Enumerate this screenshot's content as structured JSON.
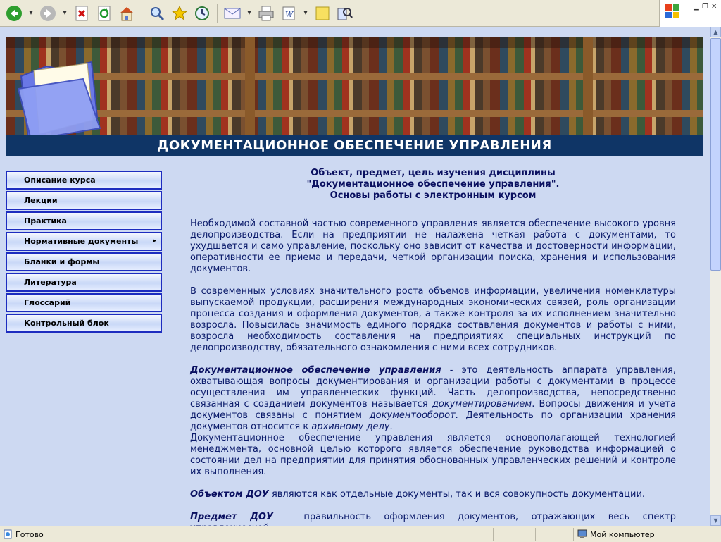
{
  "toolbar": {
    "buttons": [
      "back-icon",
      "forward-icon",
      "stop-icon",
      "refresh-icon",
      "home-icon",
      "search-icon",
      "favorites-icon",
      "history-icon",
      "mail-icon",
      "print-icon",
      "word-icon",
      "note-icon",
      "research-icon"
    ]
  },
  "header": {
    "title": "ДОКУМЕНТАЦИОННОЕ ОБЕСПЕЧЕНИЕ УПРАВЛЕНИЯ"
  },
  "menu": {
    "items": [
      {
        "label": "Описание курса"
      },
      {
        "label": "Лекции"
      },
      {
        "label": "Практика"
      },
      {
        "label": "Нормативные документы",
        "arrow": "▸"
      },
      {
        "label": "Бланки и формы"
      },
      {
        "label": "Литература"
      },
      {
        "label": "Глоссарий"
      },
      {
        "label": "Контрольный блок"
      }
    ]
  },
  "main": {
    "heading_line1": "Объект, предмет, цель изучения дисциплины",
    "heading_line2": "\"Документационное обеспечение управления\".",
    "heading_line3": "Основы работы с электронным курсом",
    "p1": "Необходимой составной частью современного управления является обеспечение высокого уровня делопроизводства. Если на предприятии не налажена четкая работа с документами, то ухудшается и само управление, поскольку оно зависит от качества и достоверности информации, оперативности ее приема и передачи, четкой организации поиска, хранения и использования документов.",
    "p2": "В современных условиях значительного роста объемов информации, увеличения номенклатуры выпускаемой продукции, расширения международных экономических связей, роль организации процесса создания и оформления документов, а также контроля за их исполнением значительно возросла. Повысилась значимость единого порядка составления документов и работы с ними, возросла необходимость составления на предприятиях специальных инструкций по делопроизводству, обязательного ознакомления с ними всех сотрудников.",
    "p3_term": "Документационное обеспечение управления",
    "p3_a": " - это деятельность аппарата управления, охватывающая вопросы документирования и организации работы с документами в процессе осуществления им управленческих функций. Часть делопроизводства, непосредственно связанная с созданием документов называется ",
    "p3_term2": "документированием",
    "p3_b": ". Вопросы движения и учета документов связаны с понятием ",
    "p3_term3": "документооборот",
    "p3_c": ". Деятельность по организации хранения документов относится к ",
    "p3_term4": "архивному делу",
    "p3_d": ".",
    "p4": "Документационное обеспечение управления является основополагающей технологией менеджмента, основной целью которого является обеспечение руководства информацией о состоянии дел на предприятии для принятия обоснованных управленческих решений и контроле их выполнения.",
    "p5_term": "Объектом ДОУ",
    "p5_rest": " являются как отдельные документы, так и вся совокупность документации.",
    "p6_term": "Предмет ДОУ",
    "p6_rest": " – правильность оформления документов, отражающих весь спектр управленческой"
  },
  "status": {
    "left": "Готово",
    "right": "Мой компьютер"
  }
}
